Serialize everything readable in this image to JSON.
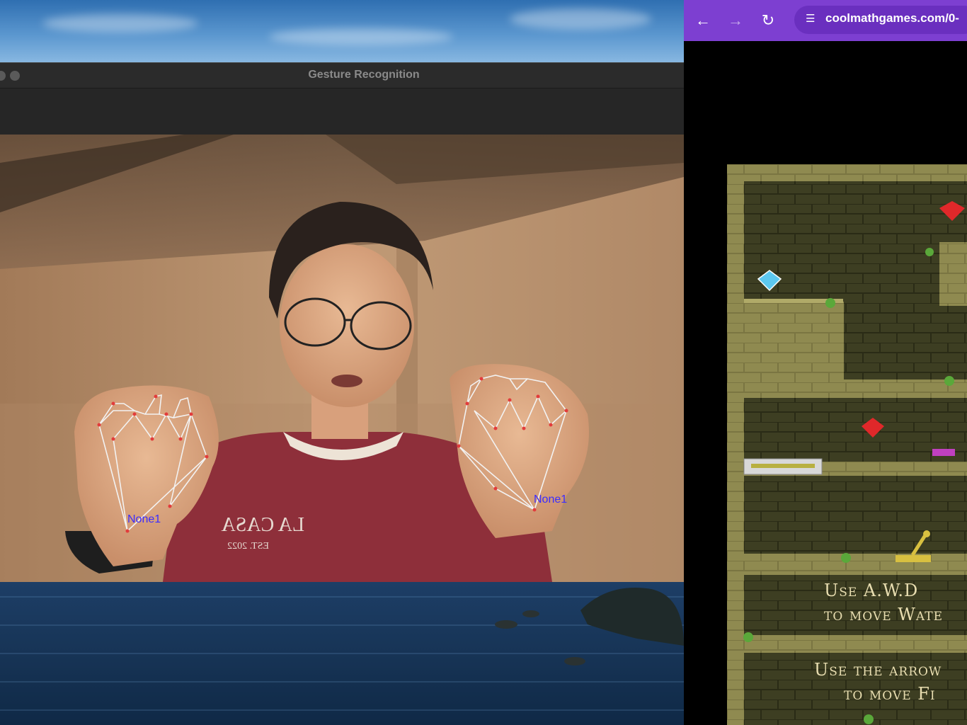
{
  "gesture_window": {
    "title": "Gesture Recognition",
    "hand_labels": [
      "None1",
      "None1"
    ],
    "shirt_text": [
      "LA CASA",
      "EST. 2022"
    ]
  },
  "browser": {
    "url": "coolmathgames.com/0-",
    "back_icon": "arrow-left-icon",
    "forward_icon": "arrow-right-icon",
    "reload_icon": "reload-icon",
    "site_settings_icon": "tune-icon"
  },
  "game": {
    "hint_water": [
      "Use  A.W.D",
      "to move Wate"
    ],
    "hint_fire": [
      "Use the arrow",
      "to move Fi"
    ]
  },
  "colors": {
    "browser_bar": "#7d3fd1",
    "titlebar": "#2b2b2b",
    "hand_label": "#3b2cff",
    "landmark_line": "#f2f2f2",
    "landmark_point": "#e23c3c"
  }
}
